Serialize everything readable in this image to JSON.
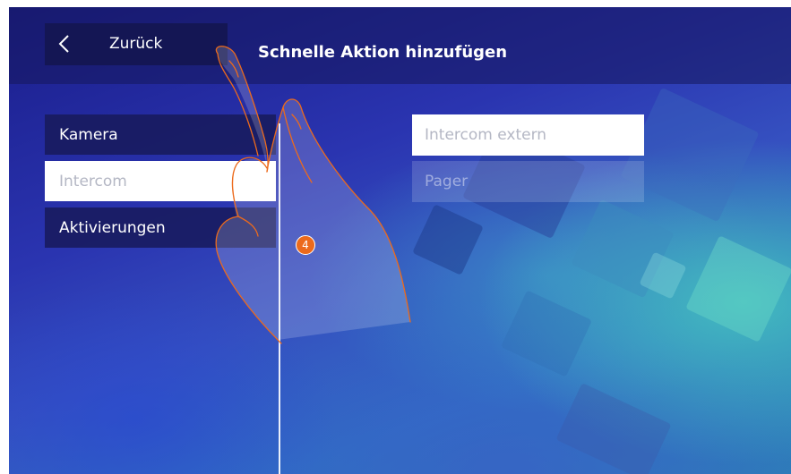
{
  "header": {
    "back_label": "Zurück",
    "title": "Schnelle Aktion hinzufügen"
  },
  "menu": {
    "items": [
      {
        "label": "Kamera",
        "state": "normal"
      },
      {
        "label": "Intercom",
        "state": "selected"
      },
      {
        "label": "Aktivierungen",
        "state": "normal"
      }
    ]
  },
  "submenu": {
    "items": [
      {
        "label": "Intercom extern",
        "state": "enabled"
      },
      {
        "label": "Pager",
        "state": "disabled"
      }
    ]
  },
  "annotation": {
    "step_number": "4"
  },
  "icons": {
    "back": "chevron-left-icon",
    "gesture": "pointing-hand-icon"
  },
  "colors": {
    "background_deep": "#1a1d8a",
    "background_teal": "#46c8be",
    "button_dark": "#141654",
    "selected_background": "#ffffff",
    "selected_text": "#b4b7c4",
    "step_badge": "#ec6a1c"
  }
}
